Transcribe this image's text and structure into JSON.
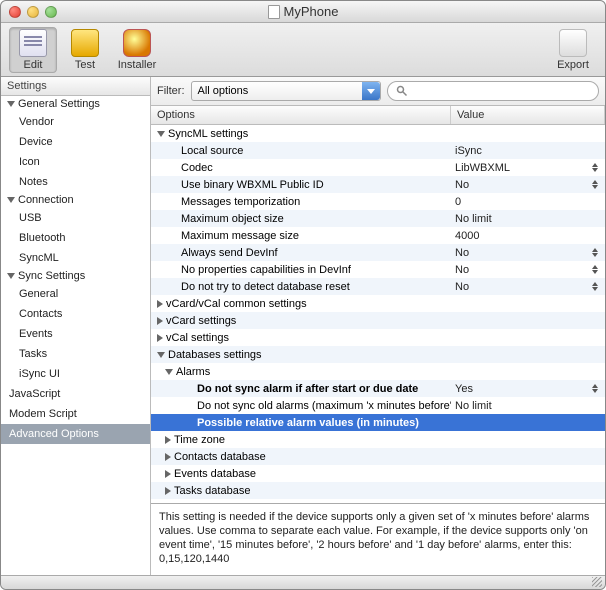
{
  "window": {
    "title": "MyPhone"
  },
  "toolbar": {
    "edit": "Edit",
    "test": "Test",
    "installer": "Installer",
    "export": "Export"
  },
  "sidebar": {
    "header": "Settings",
    "groups": [
      {
        "label": "General Settings",
        "items": [
          "Vendor",
          "Device",
          "Icon",
          "Notes"
        ]
      },
      {
        "label": "Connection",
        "items": [
          "USB",
          "Bluetooth",
          "SyncML"
        ]
      },
      {
        "label": "Sync Settings",
        "items": [
          "General",
          "Contacts",
          "Events",
          "Tasks",
          "iSync UI"
        ]
      }
    ],
    "plain": [
      "JavaScript",
      "Modem Script",
      "Advanced Options"
    ]
  },
  "filter": {
    "label": "Filter:",
    "selected": "All options",
    "search_placeholder": ""
  },
  "columns": {
    "options": "Options",
    "value": "Value"
  },
  "tree": {
    "syncml": {
      "label": "SyncML settings",
      "rows": [
        {
          "k": "Local source",
          "v": "iSync"
        },
        {
          "k": "Codec",
          "v": "LibWBXML",
          "stepper": true
        },
        {
          "k": "Use binary WBXML Public ID",
          "v": "No",
          "stepper": true
        },
        {
          "k": "Messages temporization",
          "v": "0"
        },
        {
          "k": "Maximum object size",
          "v": "No limit",
          "dim": true
        },
        {
          "k": "Maximum message size",
          "v": "4000"
        },
        {
          "k": "Always send DevInf",
          "v": "No",
          "stepper": true
        },
        {
          "k": "No properties capabilities in DevInf",
          "v": "No",
          "stepper": true
        },
        {
          "k": "Do not try to detect database reset",
          "v": "No",
          "stepper": true
        }
      ]
    },
    "vcard_common": "vCard/vCal common settings",
    "vcard": "vCard settings",
    "vcal": "vCal settings",
    "databases": {
      "label": "Databases settings",
      "alarms": {
        "label": "Alarms",
        "rows": [
          {
            "k": "Do not sync alarm if after start or due date",
            "v": "Yes",
            "bold": true,
            "stepper": true
          },
          {
            "k": "Do not sync old alarms (maximum 'x minutes before')",
            "v": "No limit",
            "dim": true
          },
          {
            "k": "Possible relative alarm values (in minutes)",
            "v": "",
            "selected": true,
            "bold": true
          }
        ]
      },
      "subs": [
        "Time zone",
        "Contacts database",
        "Events database",
        "Tasks database"
      ]
    }
  },
  "description": "This setting is needed if the device supports only a given set of 'x minutes before' alarms values. Use comma to separate each value. For example, if the device supports only 'on event time', '15 minutes before', '2 hours before' and '1 day before' alarms, enter this:\n0,15,120,1440"
}
